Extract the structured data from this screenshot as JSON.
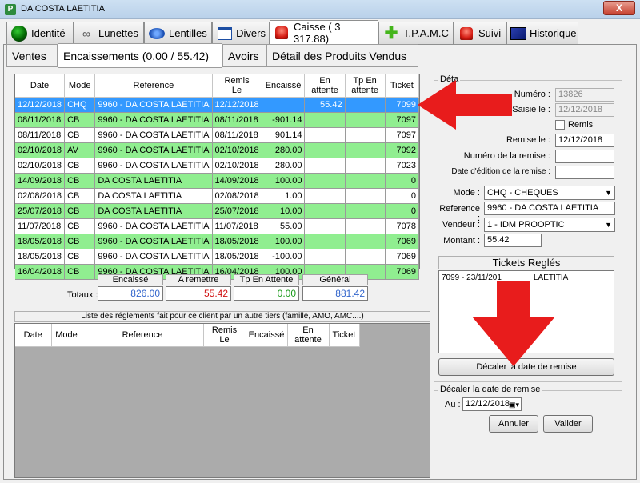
{
  "window": {
    "title": "DA COSTA LAETITIA",
    "close_label": "X",
    "app_icon_label": "P"
  },
  "main_tabs": [
    {
      "label": "Identité",
      "icon": "identite-icon"
    },
    {
      "label": "Lunettes",
      "icon": "glasses-icon"
    },
    {
      "label": "Lentilles",
      "icon": "lens-icon"
    },
    {
      "label": "Divers",
      "icon": "divers-icon"
    },
    {
      "label": "Caisse ( 3 317.88)",
      "icon": "alarm-light-icon"
    },
    {
      "label": "T.P.A.M.C",
      "icon": "plus-cross-icon"
    },
    {
      "label": "Suivi",
      "icon": "alarm-light-icon"
    },
    {
      "label": "Historique",
      "icon": "history-book-icon"
    }
  ],
  "sub_tabs": [
    "Ventes",
    "Encaissements (0.00 / 55.42)",
    "Avoirs",
    "Détail des Produits Vendus"
  ],
  "grid": {
    "headers": [
      "Date",
      "Mode",
      "Reference",
      "Remis\nLe",
      "Encaissé",
      "En\nattente",
      "Tp En\nattente",
      "Ticket"
    ],
    "rows": [
      {
        "style": "sel",
        "cells": [
          "12/12/2018",
          "CHQ",
          "9960 - DA COSTA LAETITIA",
          "12/12/2018",
          "",
          "55.42",
          "",
          "7099"
        ]
      },
      {
        "style": "green",
        "cells": [
          "08/11/2018",
          "CB",
          "9960 - DA COSTA LAETITIA",
          "08/11/2018",
          "-901.14",
          "",
          "",
          "7097"
        ]
      },
      {
        "style": "white",
        "cells": [
          "08/11/2018",
          "CB",
          "9960 - DA COSTA LAETITIA",
          "08/11/2018",
          "901.14",
          "",
          "",
          "7097"
        ]
      },
      {
        "style": "green",
        "cells": [
          "02/10/2018",
          "AV",
          "9960 - DA COSTA LAETITIA",
          "02/10/2018",
          "280.00",
          "",
          "",
          "7092"
        ]
      },
      {
        "style": "white",
        "cells": [
          "02/10/2018",
          "CB",
          "9960 - DA COSTA LAETITIA",
          "02/10/2018",
          "280.00",
          "",
          "",
          "7023"
        ]
      },
      {
        "style": "green",
        "cells": [
          "14/09/2018",
          "CB",
          "DA COSTA LAETITIA",
          "14/09/2018",
          "100.00",
          "",
          "",
          "0"
        ]
      },
      {
        "style": "white",
        "cells": [
          "02/08/2018",
          "CB",
          "DA COSTA LAETITIA",
          "02/08/2018",
          "1.00",
          "",
          "",
          "0"
        ]
      },
      {
        "style": "green",
        "cells": [
          "25/07/2018",
          "CB",
          "DA COSTA LAETITIA",
          "25/07/2018",
          "10.00",
          "",
          "",
          "0"
        ]
      },
      {
        "style": "white",
        "cells": [
          "11/07/2018",
          "CB",
          "9960 - DA COSTA LAETITIA",
          "11/07/2018",
          "55.00",
          "",
          "",
          "7078"
        ]
      },
      {
        "style": "green",
        "cells": [
          "18/05/2018",
          "CB",
          "9960 - DA COSTA LAETITIA",
          "18/05/2018",
          "100.00",
          "",
          "",
          "7069"
        ]
      },
      {
        "style": "white",
        "cells": [
          "18/05/2018",
          "CB",
          "9960 - DA COSTA LAETITIA",
          "18/05/2018",
          "-100.00",
          "",
          "",
          "7069"
        ]
      },
      {
        "style": "green",
        "cells": [
          "16/04/2018",
          "CB",
          "9960 - DA COSTA LAETITIA",
          "16/04/2018",
          "100.00",
          "",
          "",
          "7069"
        ]
      }
    ]
  },
  "totals": {
    "label": "Totaux :",
    "encaisse_label": "Encaissé",
    "encaisse_value": "826.00",
    "encaisse_color": "#3366cc",
    "remettre_label": "A remettre",
    "remettre_value": "55.42",
    "remettre_color": "#d01010",
    "tp_label": "Tp En Attente",
    "tp_value": "0.00",
    "tp_color": "#1a9a1a",
    "general_label": "Général",
    "general_value": "881.42",
    "general_color": "#3366cc"
  },
  "third_party": {
    "caption": "Liste des réglements fait pour ce client par un autre tiers (famille, AMO, AMC....)",
    "headers": [
      "Date",
      "Mode",
      "Reference",
      "Remis\nLe",
      "Encaissé",
      "En\nattente",
      "Ticket"
    ]
  },
  "detail": {
    "group_label": "Déta",
    "numero_label": "Numéro :",
    "numero_value": "13826",
    "saisie_label": "Saisie le :",
    "saisie_value": "12/12/2018",
    "remis_chk_label": "Remis",
    "remise_label": "Remise le :",
    "remise_value": "12/12/2018",
    "num_remise_label": "Numéro de la remise :",
    "num_remise_value": "",
    "date_edition_label": "Date d'édition de la remise :",
    "date_edition_value": "",
    "mode_label": "Mode :",
    "mode_value": "CHQ - CHEQUES",
    "reference_label": "Reference :",
    "reference_value": "9960 - DA COSTA LAETITIA",
    "vendeur_label": "Vendeur :",
    "vendeur_value": "1 - IDM PROOPTIC",
    "montant_label": "Montant :",
    "montant_value": "55.42"
  },
  "tickets": {
    "title": "Tickets Reglés",
    "items_left": "7099 - 23/11/201",
    "items_right": "LAETITIA"
  },
  "decaler_button": "Décaler la date de remise",
  "decaler_group": {
    "title": "Décaler la date de remise",
    "au_label": "Au :",
    "date_value": "12/12/2018",
    "annuler": "Annuler",
    "valider": "Valider"
  },
  "annotation_color": "#e81c1c"
}
